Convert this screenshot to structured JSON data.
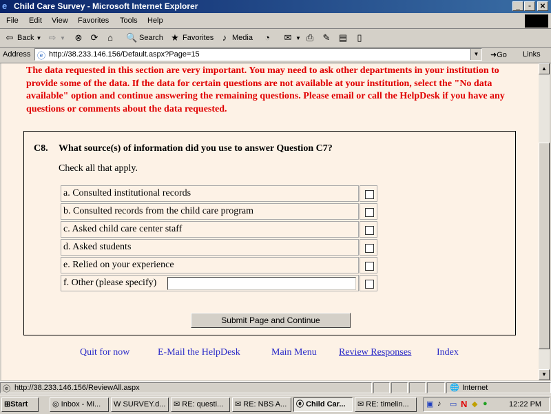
{
  "window": {
    "title": "Child Care Survey - Microsoft Internet Explorer"
  },
  "menu": [
    "File",
    "Edit",
    "View",
    "Favorites",
    "Tools",
    "Help"
  ],
  "toolbar": {
    "back": "Back",
    "search": "Search",
    "favorites": "Favorites",
    "media": "Media"
  },
  "address": {
    "label": "Address",
    "url": "http://38.233.146.156/Default.aspx?Page=15",
    "go": "Go",
    "links": "Links"
  },
  "notice": "The data requested in this section are very important. You may need to ask other departments in your institution to provide some of the data. If the data for certain questions are not available at your institution, select the \"No data available\" option and continue answering the remaining questions. Please email or call the HelpDesk if you have any questions or comments about the data requested.",
  "question": {
    "number": "C8.",
    "text": "What source(s) of information did you use to answer Question C7?",
    "instruction": "Check all that apply.",
    "options": [
      "a. Consulted institutional records",
      "b. Consulted records from the child care program",
      "c. Asked child care center staff",
      "d. Asked students",
      "e. Relied on your experience",
      "f. Other (please specify)"
    ],
    "other_value": ""
  },
  "submit_label": "Submit Page and Continue",
  "footer_links": [
    "Quit for now",
    "E-Mail the HelpDesk",
    "Main Menu",
    "Review Responses",
    "Index"
  ],
  "status": {
    "url": "http://38.233.146.156/ReviewAll.aspx",
    "zone": "Internet"
  },
  "taskbar": {
    "start": "Start",
    "tasks": [
      "Inbox - Mi...",
      "SURVEY.d...",
      "RE: questi...",
      "RE: NBS A...",
      "Child Car...",
      "RE: timelin..."
    ],
    "clock": "12:22 PM"
  }
}
